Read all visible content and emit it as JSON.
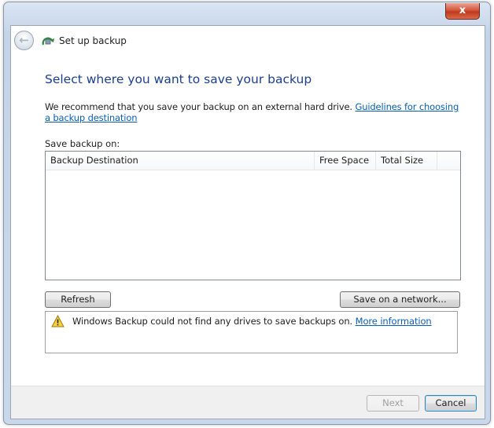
{
  "window": {
    "title": "Set up backup",
    "close_label": "x"
  },
  "main": {
    "heading": "Select where you want to save your backup",
    "recommend_text": "We recommend that you save your backup on an external hard drive. ",
    "guidelines_link": "Guidelines for choosing a backup destination",
    "save_label": "Save backup on:"
  },
  "table": {
    "columns": [
      "Backup Destination",
      "Free Space",
      "Total Size"
    ]
  },
  "buttons": {
    "refresh": "Refresh",
    "network": "Save on a network...",
    "next": "Next",
    "cancel": "Cancel"
  },
  "message": {
    "icon": "warning-icon",
    "text": "Windows Backup could not find any drives to save backups on. ",
    "link": "More information"
  },
  "colors": {
    "heading": "#1b3e8e",
    "link": "#0a5fb4"
  }
}
